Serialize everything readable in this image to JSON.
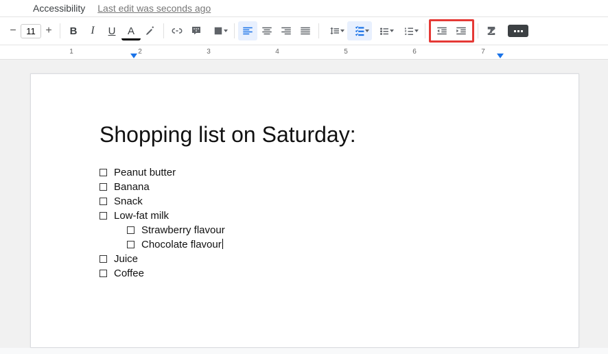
{
  "menubar": {
    "accessibility": "Accessibility",
    "history": "Last edit was seconds ago"
  },
  "toolbar": {
    "font_size": "11",
    "bold_glyph": "B",
    "italic_glyph": "I",
    "underline_glyph": "U",
    "text_color_glyph": "A"
  },
  "ruler": {
    "numbers": [
      "1",
      "2",
      "3",
      "4",
      "5",
      "6",
      "7"
    ]
  },
  "doc": {
    "title": "Shopping list on Saturday:",
    "items": [
      "Peanut butter",
      "Banana",
      "Snack",
      "Low-fat milk",
      "Juice",
      "Coffee"
    ],
    "lowfat_sub": [
      "Strawberry flavour",
      "Chocolate flavour"
    ]
  }
}
